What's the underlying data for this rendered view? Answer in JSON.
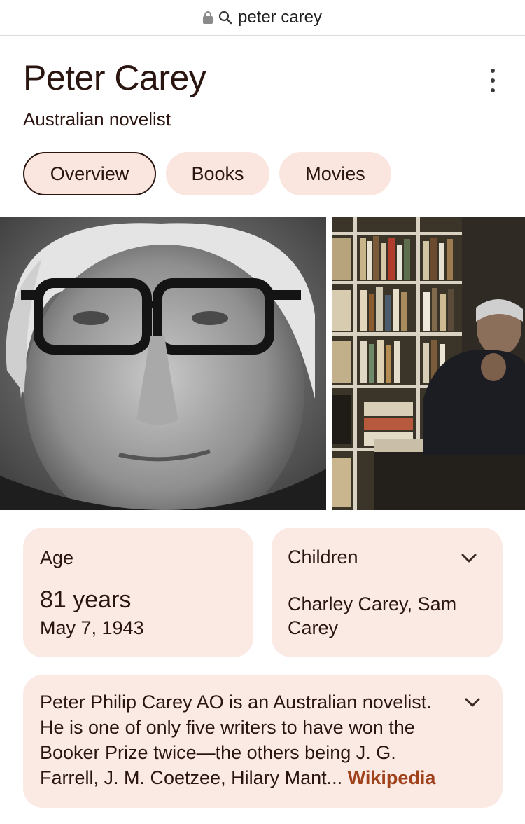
{
  "address_bar": {
    "query": "peter carey",
    "lock_icon": "lock-icon",
    "search_icon": "search-icon"
  },
  "entity": {
    "name": "Peter Carey",
    "description": "Australian novelist"
  },
  "tabs": [
    {
      "label": "Overview",
      "active": true
    },
    {
      "label": "Books",
      "active": false
    },
    {
      "label": "Movies",
      "active": false
    }
  ],
  "facts": {
    "age": {
      "label": "Age",
      "value": "81 years",
      "date": "May 7, 1943"
    },
    "children": {
      "label": "Children",
      "value": "Charley Carey, Sam Carey"
    }
  },
  "about": {
    "text": "Peter Philip Carey AO is an Australian novelist. He is one of only five writers to have won the Booker Prize twice—the others being J. G. Farrell, J. M. Coetzee, Hilary Mant...",
    "source": "Wikipedia"
  },
  "colors": {
    "chip_bg": "#fbe5df",
    "card_bg": "#fbe9e4",
    "link": "#a0421c",
    "text": "#2b1510"
  }
}
